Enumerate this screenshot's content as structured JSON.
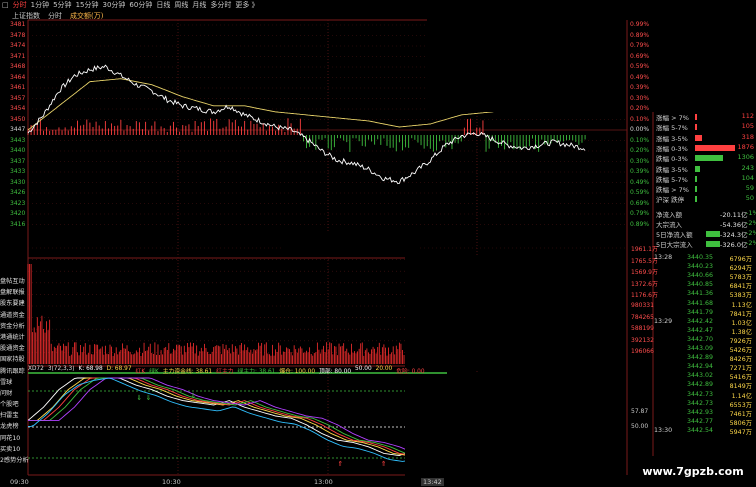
{
  "topbar": {
    "collapse_icon": "square-icon",
    "tabs": [
      "分时",
      "1分钟",
      "5分钟",
      "15分钟",
      "30分钟",
      "60分钟",
      "日线",
      "周线",
      "月线",
      "多分时",
      "更多 》"
    ]
  },
  "infobar": {
    "index_name": "上证指数",
    "view": "分时",
    "volume_label": "成交额(万)"
  },
  "price_axis": [
    "3481",
    "3478",
    "3474",
    "3471",
    "3468",
    "3464",
    "3461",
    "3457",
    "3454",
    "3450",
    "3447",
    "3443",
    "3440",
    "3437",
    "3433",
    "3430",
    "3426",
    "3423",
    "3420",
    "3416"
  ],
  "pct_axis": [
    "0.99%",
    "0.89%",
    "0.79%",
    "0.69%",
    "0.59%",
    "0.49%",
    "0.39%",
    "0.30%",
    "0.20%",
    "0.10%",
    "0.00%",
    "0.10%",
    "0.20%",
    "0.30%",
    "0.39%",
    "0.49%",
    "0.59%",
    "0.69%",
    "0.79%",
    "0.89%"
  ],
  "pct_axis_lower": [
    "0.10%",
    "0.10%",
    "0.20%",
    "0.30%",
    "0.39%",
    "0.49%",
    "0.59%",
    "0.69%",
    "0.79%",
    "0.89%"
  ],
  "volume_axis": [
    "1961.1万",
    "1765.5万",
    "1569.9万",
    "1372.6万",
    "1176.6万",
    "980331",
    "784265",
    "588199",
    "392132",
    "196066"
  ],
  "side_menu": [
    "盘帖互动",
    "盘解联报",
    "股东要建",
    "通道资金",
    "资金分析",
    "港通统计",
    "股通资金",
    "国家持股",
    "腾讯跟踪",
    "雪球",
    "问财",
    "个股吧",
    "扫雷宝",
    "龙虎榜",
    "同花10",
    "买卖10",
    "2感势分析"
  ],
  "osc_header": {
    "name": "XD72",
    "params": "3(72,3,3)",
    "k": "K: 68.98",
    "d": "D: 68.97",
    "red": "红K",
    "green": "绿K",
    "main_fund": "主力资金线: 38.61",
    "main_red": "红主力",
    "main_green": "绿主力: 38.61",
    "safe": "爆仓: 100.00",
    "top": "顶部: 80.00",
    "mid": "50.00",
    "bottom": "20.00",
    "warn": "危险: 0.00"
  },
  "osc_axis": [
    "57.87",
    "50.00"
  ],
  "time_axis": [
    "09:30",
    "10:30",
    "13:00",
    "13:42"
  ],
  "breadth": [
    {
      "label": "涨幅 > 7%",
      "value": "112",
      "frac": 0.06,
      "color": "#ff4040"
    },
    {
      "label": "涨幅 5-7%",
      "value": "105",
      "frac": 0.06,
      "color": "#ff4040"
    },
    {
      "label": "涨幅 3-5%",
      "value": "318",
      "frac": 0.17,
      "color": "#ff4040"
    },
    {
      "label": "涨幅 0-3%",
      "value": "1876",
      "frac": 1.0,
      "color": "#ff4040"
    },
    {
      "label": "跌幅 0-3%",
      "value": "1306",
      "frac": 0.7,
      "color": "#3fbf3f"
    },
    {
      "label": "跌幅 3-5%",
      "value": "243",
      "frac": 0.13,
      "color": "#3fbf3f"
    },
    {
      "label": "跌幅 5-7%",
      "value": "104",
      "frac": 0.06,
      "color": "#3fbf3f"
    },
    {
      "label": "跌幅 > 7%",
      "value": "59",
      "frac": 0.03,
      "color": "#3fbf3f"
    },
    {
      "label": "沪深 跌停",
      "value": "50",
      "frac": 0.03,
      "color": "#3fbf3f"
    }
  ],
  "flows": [
    {
      "label": "净流入额",
      "value": "-20.11亿",
      "pct": "-1%"
    },
    {
      "label": "大宗流入",
      "value": "-54.36亿",
      "pct": "-2%"
    },
    {
      "label": "5日净流入额",
      "value": "-324.3亿",
      "pct": "-2%"
    },
    {
      "label": "5日大宗流入",
      "value": "-326.0亿",
      "pct": "-2%"
    }
  ],
  "ticks": [
    {
      "time": "13:28",
      "price": "3440.35",
      "vol": "6796万",
      "up": false
    },
    {
      "time": "",
      "price": "3440.23",
      "vol": "6294万",
      "up": false
    },
    {
      "time": "",
      "price": "3440.66",
      "vol": "5783万",
      "up": false
    },
    {
      "time": "",
      "price": "3440.85",
      "vol": "6841万",
      "up": false
    },
    {
      "time": "",
      "price": "3441.36",
      "vol": "5383万",
      "up": false
    },
    {
      "time": "",
      "price": "3441.68",
      "vol": "1.13亿",
      "up": false
    },
    {
      "time": "",
      "price": "3441.79",
      "vol": "7841万",
      "up": false
    },
    {
      "time": "13:29",
      "price": "3442.42",
      "vol": "1.03亿",
      "up": false
    },
    {
      "time": "",
      "price": "3442.47",
      "vol": "1.38亿",
      "up": false
    },
    {
      "time": "",
      "price": "3442.70",
      "vol": "7926万",
      "up": false
    },
    {
      "time": "",
      "price": "3443.09",
      "vol": "5426万",
      "up": false
    },
    {
      "time": "",
      "price": "3442.89",
      "vol": "8426万",
      "up": false
    },
    {
      "time": "",
      "price": "3442.94",
      "vol": "7271万",
      "up": false
    },
    {
      "time": "",
      "price": "3443.02",
      "vol": "5416万",
      "up": false
    },
    {
      "time": "",
      "price": "3442.89",
      "vol": "8149万",
      "up": false
    },
    {
      "time": "",
      "price": "3442.73",
      "vol": "1.14亿",
      "up": false
    },
    {
      "time": "",
      "price": "3442.73",
      "vol": "6553万",
      "up": false
    },
    {
      "time": "",
      "price": "3442.93",
      "vol": "7461万",
      "up": false
    },
    {
      "time": "",
      "price": "3442.77",
      "vol": "5806万",
      "up": false
    },
    {
      "time": "13:30",
      "price": "3442.54",
      "vol": "5947万",
      "up": false
    }
  ],
  "watermark": "www.7gpzb.com",
  "colors": {
    "up": "#ff4040",
    "down": "#3fbf3f",
    "avg_line": "#e8d36a",
    "price_line": "#ffffff",
    "grid": "#8a1f1f"
  }
}
